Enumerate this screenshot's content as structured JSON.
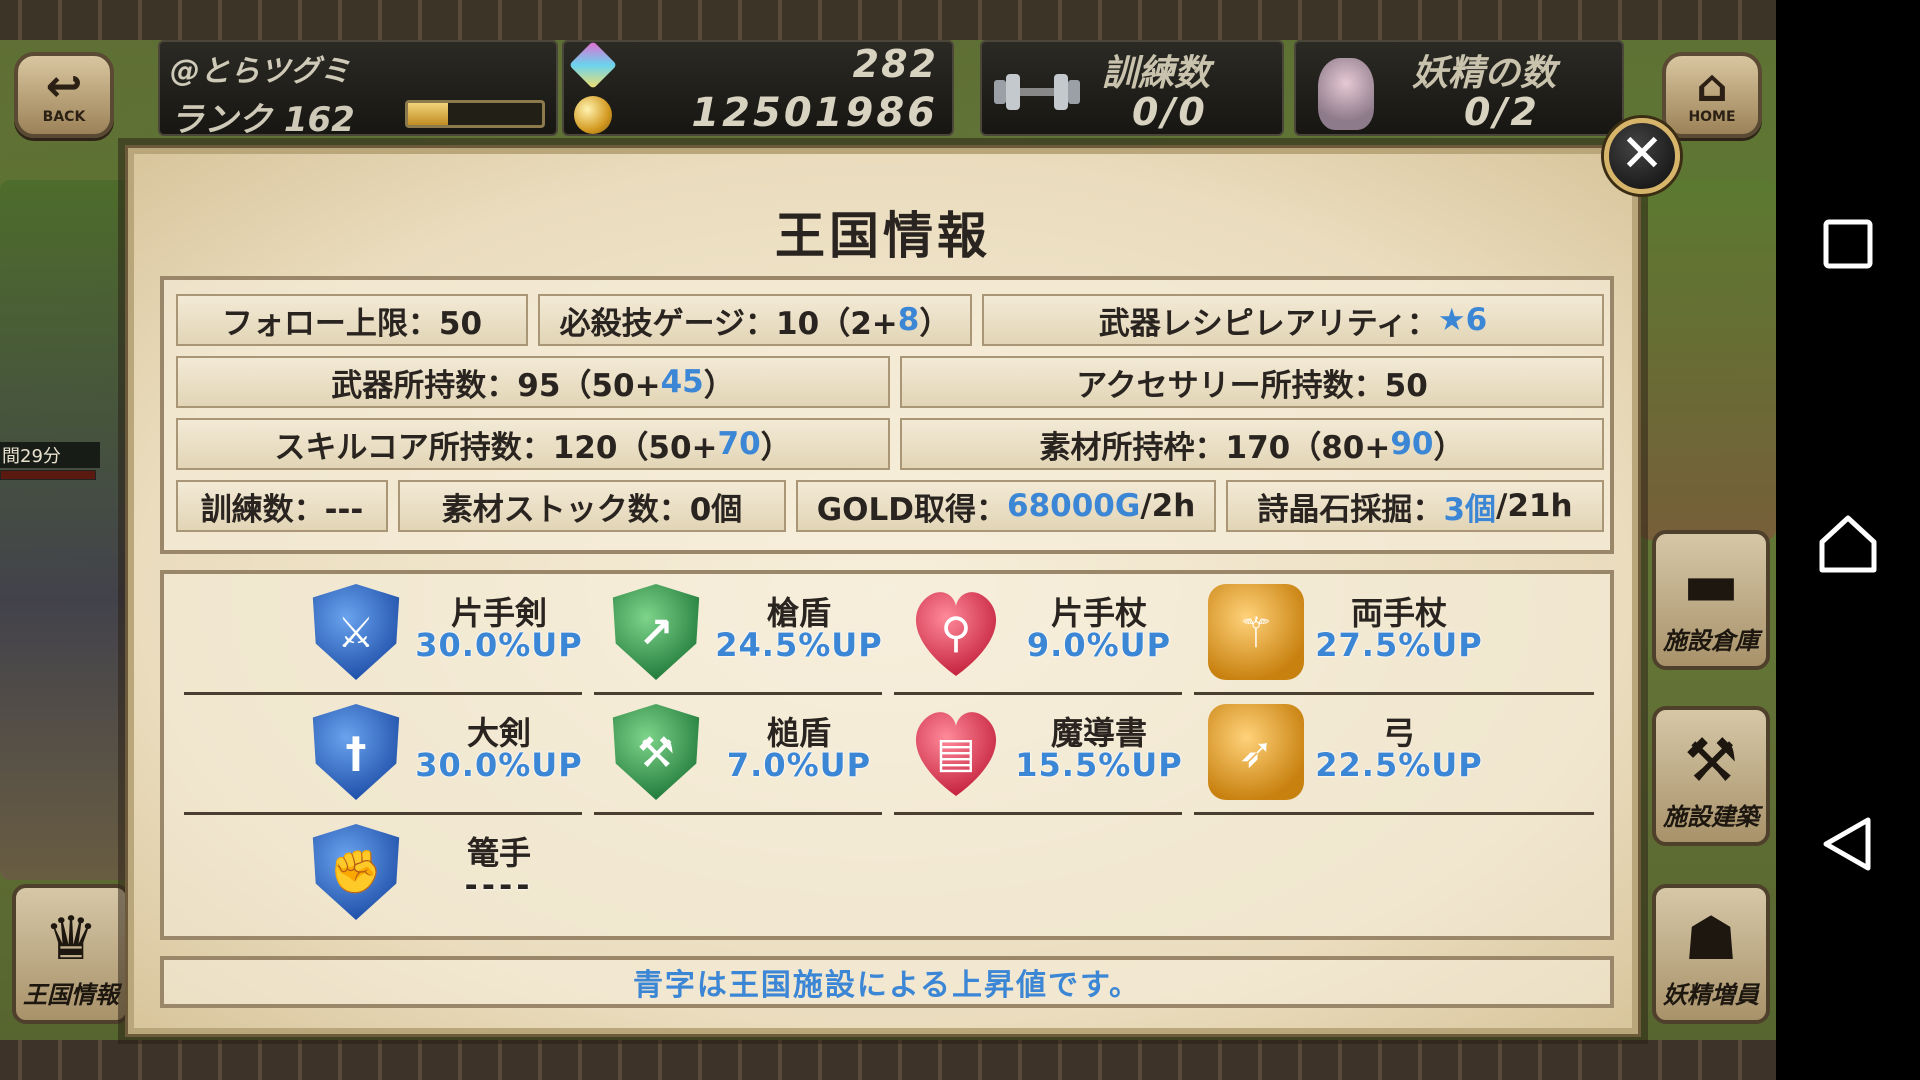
{
  "hud": {
    "back_label": "BACK",
    "home_label": "HOME",
    "player_name": "@とらツグミ",
    "rank_text": "ランク 162",
    "rank_progress": 0.3,
    "gems": "282",
    "gold": "12501986",
    "training_title": "訓練数",
    "training_value": "0/0",
    "fairy_title": "妖精の数",
    "fairy_value": "0/2",
    "timer_text": "間29分"
  },
  "side_buttons": {
    "kingdom_info": "王国情報",
    "facility_storage": "施設倉庫",
    "facility_build": "施設建築",
    "fairy_increase": "妖精増員"
  },
  "modal": {
    "title": "王国情報",
    "close_symbol": "✕",
    "stats": {
      "follow_limit": "フォロー上限：50",
      "special_gauge_prefix": "必殺技ゲージ：10（2+",
      "special_gauge_bonus": "8",
      "special_gauge_suffix": "）",
      "recipe_rarity_prefix": "武器レシピレアリティ：",
      "recipe_rarity_bonus": "★6",
      "weapons_prefix": "武器所持数：95（50+",
      "weapons_bonus": "45",
      "weapons_suffix": "）",
      "accessories": "アクセサリー所持数：50",
      "skillcore_prefix": "スキルコア所持数：120（50+",
      "skillcore_bonus": "70",
      "skillcore_suffix": "）",
      "material_slots_prefix": "素材所持枠：170（80+",
      "material_slots_bonus": "90",
      "material_slots_suffix": "）",
      "training": "訓練数：---",
      "material_stock": "素材ストック数：0個",
      "gold_prefix": "GOLD取得：",
      "gold_bonus": "68000G",
      "gold_suffix": "/2h",
      "gem_prefix": "詩晶石採掘：",
      "gem_bonus": "3個",
      "gem_suffix": "/21h"
    },
    "weapons": [
      {
        "name": "片手剣",
        "bonus": "30.0%UP",
        "icon": "one-handed-sword-icon"
      },
      {
        "name": "槍盾",
        "bonus": "24.5%UP",
        "icon": "spear-shield-icon"
      },
      {
        "name": "片手杖",
        "bonus": "9.0%UP",
        "icon": "one-handed-staff-icon"
      },
      {
        "name": "両手杖",
        "bonus": "27.5%UP",
        "icon": "two-handed-staff-icon"
      },
      {
        "name": "大剣",
        "bonus": "30.0%UP",
        "icon": "greatsword-icon"
      },
      {
        "name": "槌盾",
        "bonus": "7.0%UP",
        "icon": "hammer-shield-icon"
      },
      {
        "name": "魔導書",
        "bonus": "15.5%UP",
        "icon": "grimoire-icon"
      },
      {
        "name": "弓",
        "bonus": "22.5%UP",
        "icon": "bow-icon"
      },
      {
        "name": "篭手",
        "bonus": "----",
        "icon": "gauntlet-icon"
      }
    ],
    "footer_note": "青字は王国施設による上昇値です。"
  },
  "colors": {
    "bonus_blue": "#3c86d6",
    "text_dark": "#2a2420",
    "close_ring": "#d6b56b"
  }
}
